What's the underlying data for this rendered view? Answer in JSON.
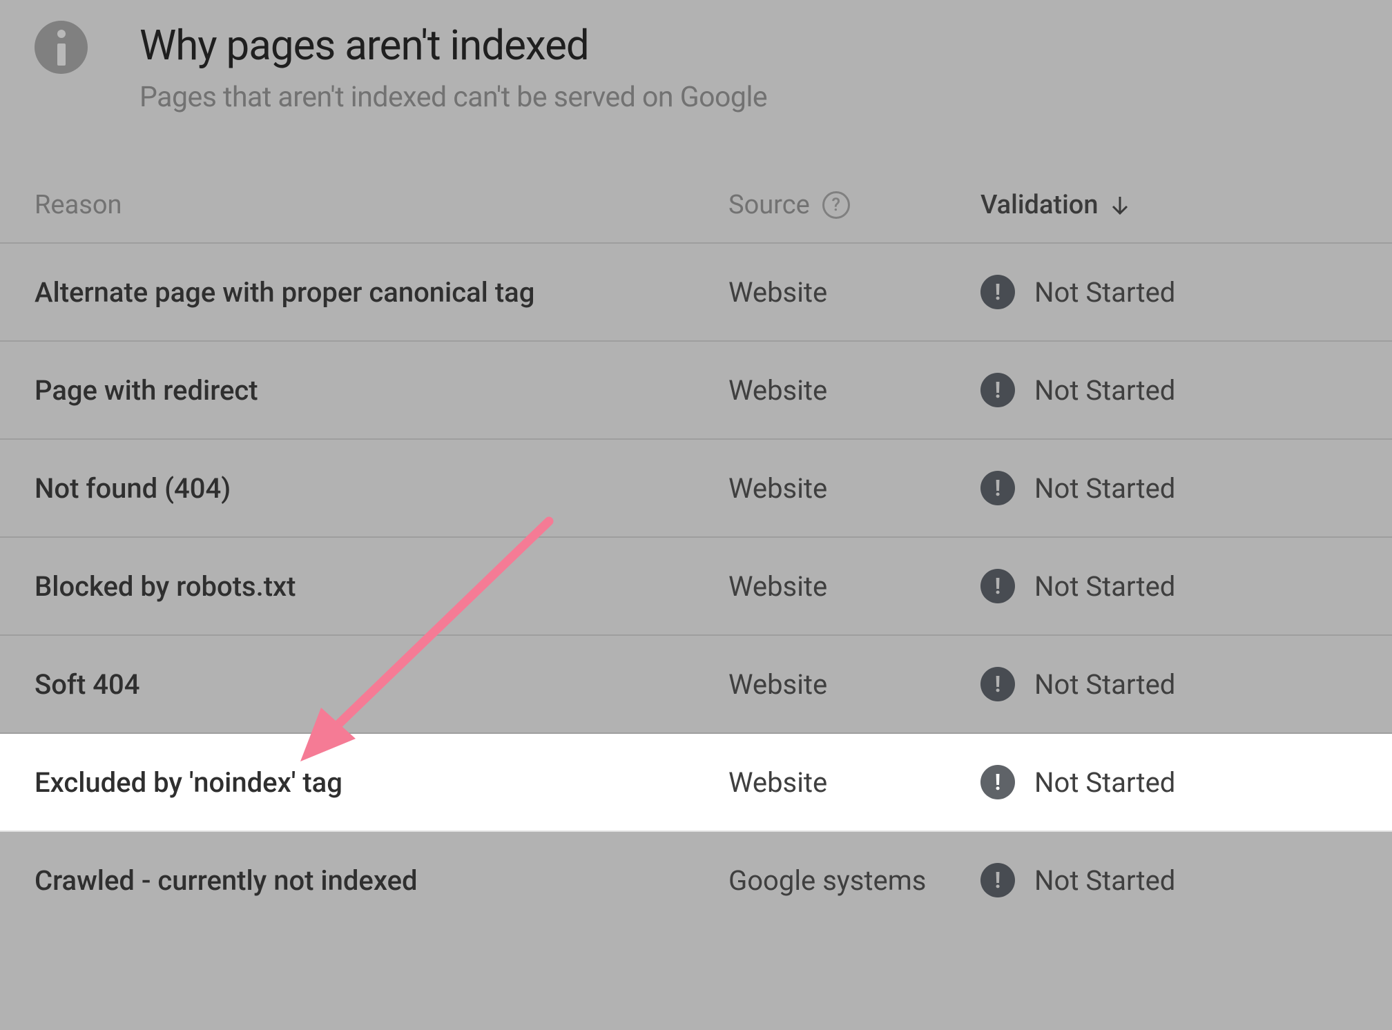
{
  "header": {
    "title": "Why pages aren't indexed",
    "subtitle": "Pages that aren't indexed can't be served on Google"
  },
  "table": {
    "columns": {
      "reason": "Reason",
      "source": "Source",
      "validation": "Validation"
    },
    "rows": [
      {
        "reason": "Alternate page with proper canonical tag",
        "source": "Website",
        "validation": "Not Started",
        "highlight": false
      },
      {
        "reason": "Page with redirect",
        "source": "Website",
        "validation": "Not Started",
        "highlight": false
      },
      {
        "reason": "Not found (404)",
        "source": "Website",
        "validation": "Not Started",
        "highlight": false
      },
      {
        "reason": "Blocked by robots.txt",
        "source": "Website",
        "validation": "Not Started",
        "highlight": false
      },
      {
        "reason": "Soft 404",
        "source": "Website",
        "validation": "Not Started",
        "highlight": false
      },
      {
        "reason": "Excluded by 'noindex' tag",
        "source": "Website",
        "validation": "Not Started",
        "highlight": true
      },
      {
        "reason": "Crawled - currently not indexed",
        "source": "Google systems",
        "validation": "Not Started",
        "highlight": false
      }
    ]
  },
  "annotation": {
    "arrow_color": "#f57b95"
  }
}
